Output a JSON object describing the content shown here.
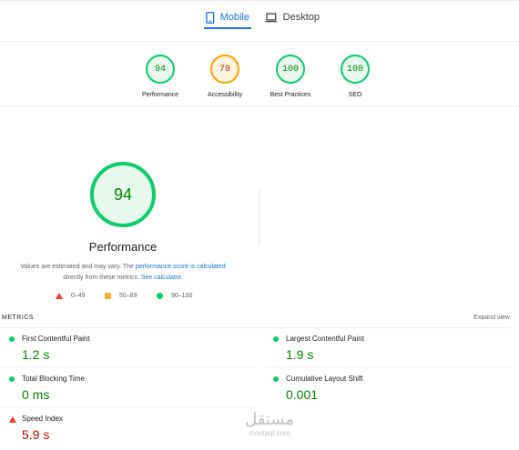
{
  "tabs": {
    "mobile": "Mobile",
    "desktop": "Desktop"
  },
  "scores": [
    {
      "value": "94",
      "label": "Performance",
      "color": "#0cce6b",
      "text_color": "#008800"
    },
    {
      "value": "79",
      "label": "Accessibility",
      "color": "#ffa400",
      "text_color": "#c33300"
    },
    {
      "value": "100",
      "label": "Best Practices",
      "color": "#0cce6b",
      "text_color": "#008800"
    },
    {
      "value": "100",
      "label": "SEO",
      "color": "#0cce6b",
      "text_color": "#008800"
    }
  ],
  "main": {
    "score": "94",
    "title": "Performance",
    "note_prefix": "Values are estimated and may vary. The ",
    "note_link1": "performance score is calculated",
    "note_mid": "directly from these metrics. ",
    "note_link2": "See calculator."
  },
  "legend": {
    "fail": "0–49",
    "average": "50–89",
    "pass": "90–100"
  },
  "metrics_header": {
    "title": "METRICS",
    "expand": "Expand view"
  },
  "metrics": [
    {
      "name": "First Contentful Paint",
      "value": "1.2 s",
      "status": "pass"
    },
    {
      "name": "Largest Contentful Paint",
      "value": "1.9 s",
      "status": "pass"
    },
    {
      "name": "Total Blocking Time",
      "value": "0 ms",
      "status": "pass"
    },
    {
      "name": "Cumulative Layout Shift",
      "value": "0.001",
      "status": "pass"
    },
    {
      "name": "Speed Index",
      "value": "5.9 s",
      "status": "fail"
    }
  ],
  "watermark": {
    "arabic": "مستقل",
    "latin": "mostaql.com"
  }
}
